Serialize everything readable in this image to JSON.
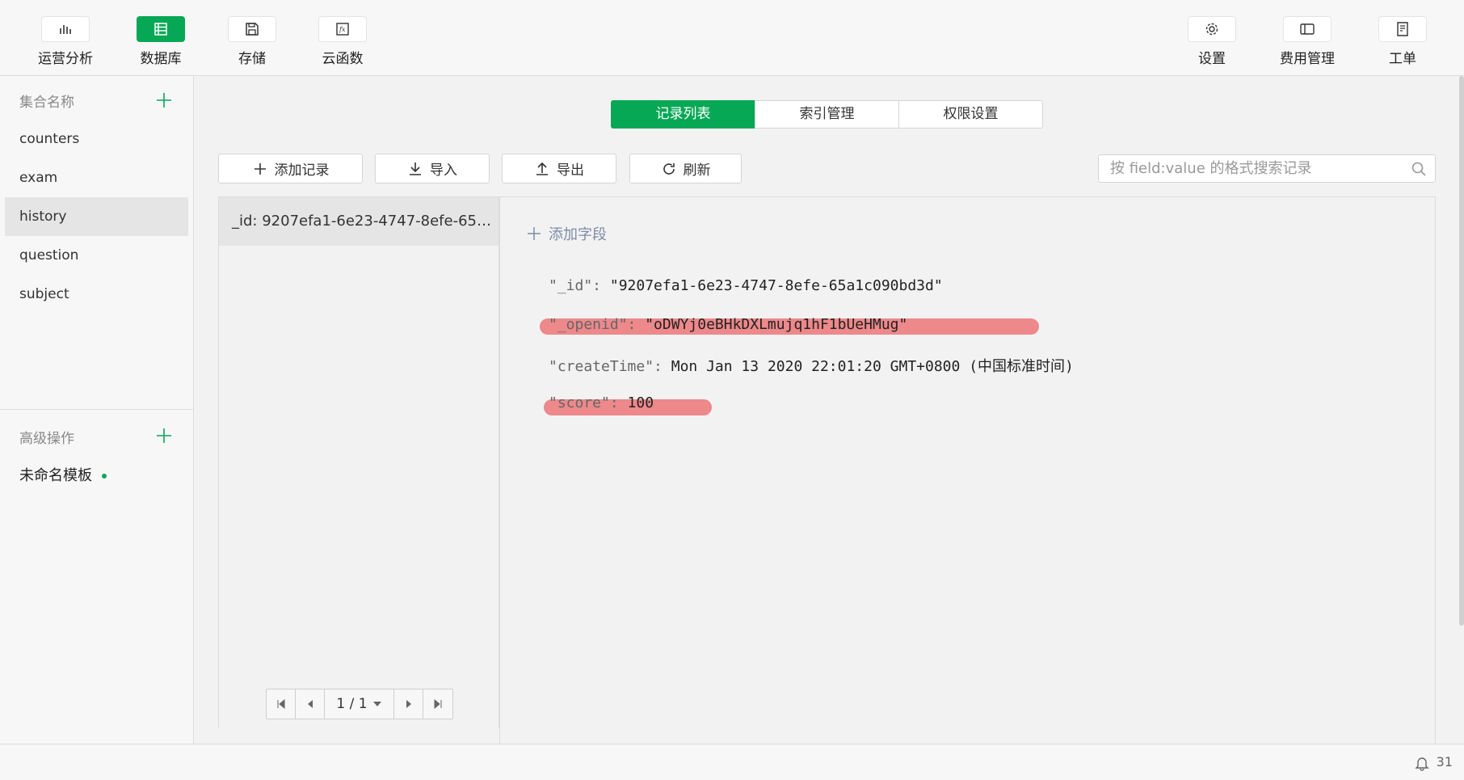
{
  "toolbar": {
    "left": [
      {
        "label": "运营分析",
        "icon": "bar-chart-icon"
      },
      {
        "label": "数据库",
        "icon": "database-icon",
        "active": true
      },
      {
        "label": "存储",
        "icon": "save-disk-icon"
      },
      {
        "label": "云函数",
        "icon": "function-icon"
      }
    ],
    "right": [
      {
        "label": "设置",
        "icon": "gear-icon"
      },
      {
        "label": "费用管理",
        "icon": "billing-icon"
      },
      {
        "label": "工单",
        "icon": "ticket-icon"
      }
    ]
  },
  "sidebar": {
    "collections_title": "集合名称",
    "collections": [
      "counters",
      "exam",
      "history",
      "question",
      "subject"
    ],
    "active_collection": "history",
    "advanced_title": "高级操作",
    "template_label": "未命名模板"
  },
  "tabs": [
    "记录列表",
    "索引管理",
    "权限设置"
  ],
  "actions": {
    "add_record": "添加记录",
    "import": "导入",
    "export": "导出",
    "refresh": "刷新"
  },
  "search": {
    "placeholder": "按 field:value 的格式搜索记录"
  },
  "records": {
    "items": [
      "_id: 9207efa1-6e23-4747-8efe-65a..."
    ],
    "pager": "1 / 1"
  },
  "detail": {
    "add_field": "添加字段",
    "fields": [
      {
        "key": "\"_id\":",
        "value": "\"9207efa1-6e23-4747-8efe-65a1c090bd3d\""
      },
      {
        "key": "\"_openid\":",
        "value": "\"oDWYj0eBHkDXLmujq1hF1bUeHMug\""
      },
      {
        "key": "\"createTime\":",
        "value": "Mon Jan 13 2020 22:01:20 GMT+0800 (中国标准时间)"
      },
      {
        "key": "\"score\":",
        "value": "100"
      }
    ]
  },
  "status": {
    "notification_count": "31"
  },
  "colors": {
    "accent": "#07a855",
    "highlight": "#ec7579"
  }
}
